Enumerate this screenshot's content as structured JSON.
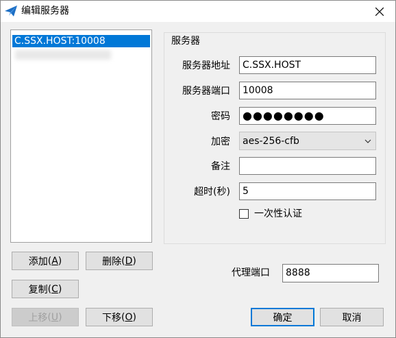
{
  "window": {
    "title": "编辑服务器",
    "close_icon": "close-icon",
    "app_icon": "paper-plane-icon"
  },
  "server_list": {
    "items": [
      {
        "label": "C.SSX.HOST:10008",
        "selected": true
      },
      {
        "label": "",
        "blurred": true
      }
    ]
  },
  "list_buttons": {
    "add": {
      "label": "添加",
      "accel": "A"
    },
    "delete": {
      "label": "删除",
      "accel": "D"
    },
    "copy": {
      "label": "复制",
      "accel": "C"
    },
    "move_up": {
      "label": "上移",
      "accel": "U"
    },
    "move_down": {
      "label": "下移",
      "accel": "O"
    }
  },
  "server_group": {
    "legend": "服务器",
    "address_label": "服务器地址",
    "address_value": "C.SSX.HOST",
    "port_label": "服务器端口",
    "port_value": "10008",
    "password_label": "密码",
    "password_mask": "●●●●●●●●",
    "encryption_label": "加密",
    "encryption_value": "aes-256-cfb",
    "remarks_label": "备注",
    "remarks_value": "",
    "timeout_label": "超时(秒)",
    "timeout_value": "5",
    "onetime_auth_label": "一次性认证",
    "onetime_auth_checked": false
  },
  "proxy": {
    "label": "代理端口",
    "value": "8888"
  },
  "dialog_buttons": {
    "ok": "确定",
    "cancel": "取消"
  },
  "colors": {
    "selection": "#0078d7",
    "background": "#f0f0f0"
  }
}
